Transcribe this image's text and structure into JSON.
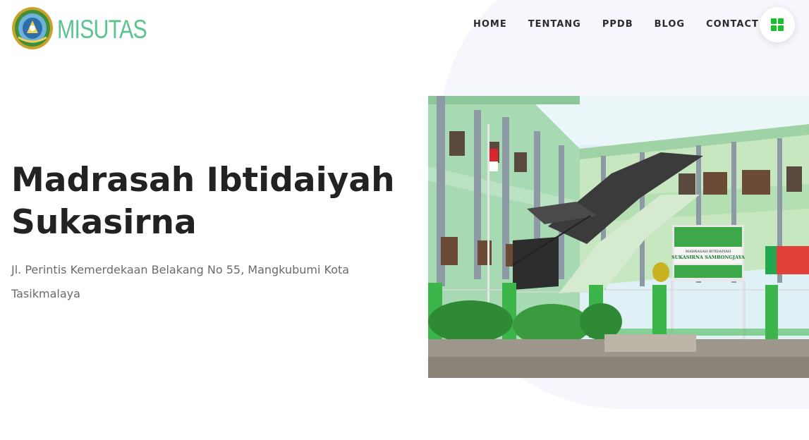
{
  "brand": {
    "name": "MISUTAS",
    "logo_icon": "school-emblem-icon"
  },
  "nav": {
    "items": [
      {
        "label": "HOME"
      },
      {
        "label": "TENTANG"
      },
      {
        "label": "PPDB"
      },
      {
        "label": "BLOG"
      },
      {
        "label": "CONTACT"
      }
    ],
    "menu_icon": "grid-menu-icon"
  },
  "hero": {
    "title_line1": "Madrasah Ibtidaiyah",
    "title_line2": "Sukasirna",
    "address_line1": "Jl. Perintis Kemerdekaan Belakang No 55, Mangkubumi Kota",
    "address_line2": "Tasikmalaya",
    "image": {
      "alt": "school-building-photo",
      "sign_line1": "MADRASAH IBTIDAIYAH",
      "sign_line2": "SUKASIRNA SAMBONGJAYA"
    }
  },
  "colors": {
    "brand_green": "#5cc48f",
    "menu_icon_green": "#18c12b",
    "heading": "#222222",
    "body_text": "#6b6b6b",
    "blob": "#f5f7fd"
  }
}
